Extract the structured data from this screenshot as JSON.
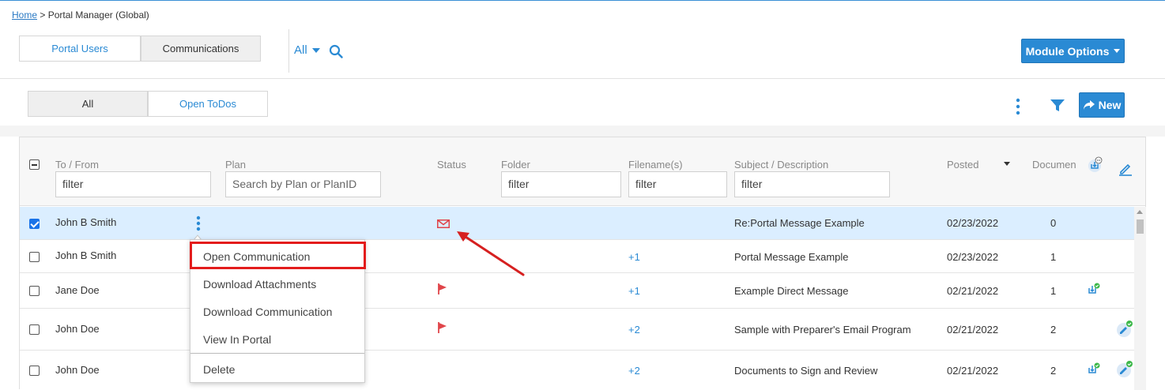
{
  "breadcrumb": {
    "home": "Home",
    "separator": ">",
    "current": "Portal Manager (Global)"
  },
  "top_tabs": [
    {
      "label": "Portal Users"
    },
    {
      "label": "Communications"
    }
  ],
  "scope_selector": {
    "value": "All"
  },
  "module_options_label": "Module Options",
  "sub_tabs": [
    {
      "label": "All"
    },
    {
      "label": "Open ToDos"
    }
  ],
  "new_button_label": "New",
  "columns": {
    "to_from": "To / From",
    "plan": "Plan",
    "status": "Status",
    "folder": "Folder",
    "filenames": "Filename(s)",
    "subject": "Subject / Description",
    "posted": "Posted",
    "documents": "Documen"
  },
  "filters": {
    "to_from": "filter",
    "plan_placeholder": "Search by Plan or PlanID",
    "folder": "filter",
    "filenames": "filter",
    "subject": "filter"
  },
  "rows": [
    {
      "to_from": "John B Smith",
      "status": "envelope",
      "filenames": "",
      "subject": "Re:Portal Message Example",
      "posted": "02/23/2022",
      "documents": "0",
      "checked": true
    },
    {
      "to_from": "John B Smith",
      "status": "",
      "filenames": "+1",
      "subject": "Portal Message Example",
      "posted": "02/23/2022",
      "documents": "1",
      "checked": false
    },
    {
      "to_from": "Jane Doe",
      "status": "flag",
      "filenames": "+1",
      "subject": "Example Direct Message",
      "posted": "02/21/2022",
      "documents": "1",
      "checked": false
    },
    {
      "to_from": "John Doe",
      "status": "flag",
      "filenames": "+2",
      "subject": "Sample with Preparer's Email Program",
      "posted": "02/21/2022",
      "documents": "2",
      "checked": false
    },
    {
      "to_from": "John Doe",
      "status": "",
      "filenames": "+2",
      "subject": "Documents to Sign and Review",
      "posted": "02/21/2022",
      "documents": "2",
      "checked": false
    }
  ],
  "context_menu": [
    {
      "label": "Open Communication"
    },
    {
      "label": "Download Attachments"
    },
    {
      "label": "Download Communication"
    },
    {
      "label": "View In Portal"
    },
    {
      "label": "Delete"
    }
  ],
  "colors": {
    "accent": "#2a8ad4",
    "highlight_box": "#e31c1c",
    "selected_row": "#dbeeff",
    "flag": "#e0454a",
    "check_badge": "#3cb84a"
  }
}
